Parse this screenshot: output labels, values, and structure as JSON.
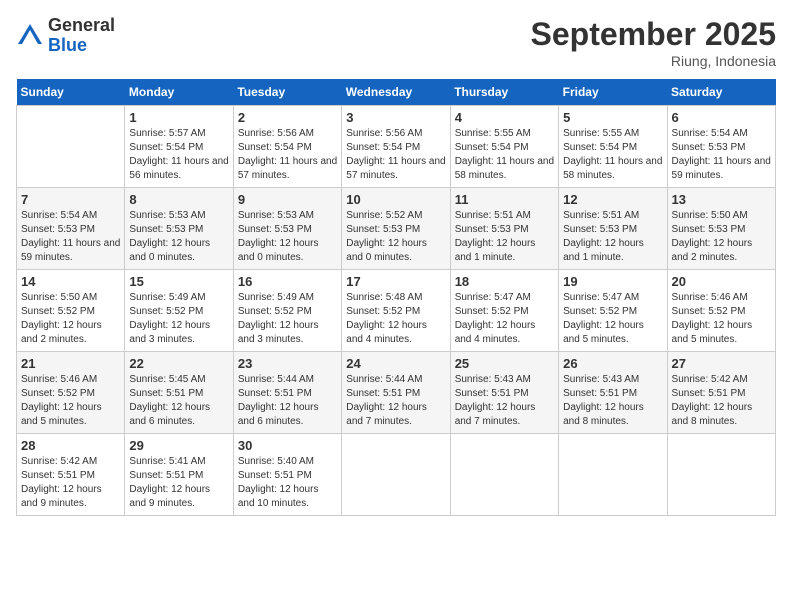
{
  "header": {
    "logo_general": "General",
    "logo_blue": "Blue",
    "month_title": "September 2025",
    "location": "Riung, Indonesia"
  },
  "weekdays": [
    "Sunday",
    "Monday",
    "Tuesday",
    "Wednesday",
    "Thursday",
    "Friday",
    "Saturday"
  ],
  "weeks": [
    [
      {
        "day": "",
        "sunrise": "",
        "sunset": "",
        "daylight": ""
      },
      {
        "day": "1",
        "sunrise": "Sunrise: 5:57 AM",
        "sunset": "Sunset: 5:54 PM",
        "daylight": "Daylight: 11 hours and 56 minutes."
      },
      {
        "day": "2",
        "sunrise": "Sunrise: 5:56 AM",
        "sunset": "Sunset: 5:54 PM",
        "daylight": "Daylight: 11 hours and 57 minutes."
      },
      {
        "day": "3",
        "sunrise": "Sunrise: 5:56 AM",
        "sunset": "Sunset: 5:54 PM",
        "daylight": "Daylight: 11 hours and 57 minutes."
      },
      {
        "day": "4",
        "sunrise": "Sunrise: 5:55 AM",
        "sunset": "Sunset: 5:54 PM",
        "daylight": "Daylight: 11 hours and 58 minutes."
      },
      {
        "day": "5",
        "sunrise": "Sunrise: 5:55 AM",
        "sunset": "Sunset: 5:54 PM",
        "daylight": "Daylight: 11 hours and 58 minutes."
      },
      {
        "day": "6",
        "sunrise": "Sunrise: 5:54 AM",
        "sunset": "Sunset: 5:53 PM",
        "daylight": "Daylight: 11 hours and 59 minutes."
      }
    ],
    [
      {
        "day": "7",
        "sunrise": "Sunrise: 5:54 AM",
        "sunset": "Sunset: 5:53 PM",
        "daylight": "Daylight: 11 hours and 59 minutes."
      },
      {
        "day": "8",
        "sunrise": "Sunrise: 5:53 AM",
        "sunset": "Sunset: 5:53 PM",
        "daylight": "Daylight: 12 hours and 0 minutes."
      },
      {
        "day": "9",
        "sunrise": "Sunrise: 5:53 AM",
        "sunset": "Sunset: 5:53 PM",
        "daylight": "Daylight: 12 hours and 0 minutes."
      },
      {
        "day": "10",
        "sunrise": "Sunrise: 5:52 AM",
        "sunset": "Sunset: 5:53 PM",
        "daylight": "Daylight: 12 hours and 0 minutes."
      },
      {
        "day": "11",
        "sunrise": "Sunrise: 5:51 AM",
        "sunset": "Sunset: 5:53 PM",
        "daylight": "Daylight: 12 hours and 1 minute."
      },
      {
        "day": "12",
        "sunrise": "Sunrise: 5:51 AM",
        "sunset": "Sunset: 5:53 PM",
        "daylight": "Daylight: 12 hours and 1 minute."
      },
      {
        "day": "13",
        "sunrise": "Sunrise: 5:50 AM",
        "sunset": "Sunset: 5:53 PM",
        "daylight": "Daylight: 12 hours and 2 minutes."
      }
    ],
    [
      {
        "day": "14",
        "sunrise": "Sunrise: 5:50 AM",
        "sunset": "Sunset: 5:52 PM",
        "daylight": "Daylight: 12 hours and 2 minutes."
      },
      {
        "day": "15",
        "sunrise": "Sunrise: 5:49 AM",
        "sunset": "Sunset: 5:52 PM",
        "daylight": "Daylight: 12 hours and 3 minutes."
      },
      {
        "day": "16",
        "sunrise": "Sunrise: 5:49 AM",
        "sunset": "Sunset: 5:52 PM",
        "daylight": "Daylight: 12 hours and 3 minutes."
      },
      {
        "day": "17",
        "sunrise": "Sunrise: 5:48 AM",
        "sunset": "Sunset: 5:52 PM",
        "daylight": "Daylight: 12 hours and 4 minutes."
      },
      {
        "day": "18",
        "sunrise": "Sunrise: 5:47 AM",
        "sunset": "Sunset: 5:52 PM",
        "daylight": "Daylight: 12 hours and 4 minutes."
      },
      {
        "day": "19",
        "sunrise": "Sunrise: 5:47 AM",
        "sunset": "Sunset: 5:52 PM",
        "daylight": "Daylight: 12 hours and 5 minutes."
      },
      {
        "day": "20",
        "sunrise": "Sunrise: 5:46 AM",
        "sunset": "Sunset: 5:52 PM",
        "daylight": "Daylight: 12 hours and 5 minutes."
      }
    ],
    [
      {
        "day": "21",
        "sunrise": "Sunrise: 5:46 AM",
        "sunset": "Sunset: 5:52 PM",
        "daylight": "Daylight: 12 hours and 5 minutes."
      },
      {
        "day": "22",
        "sunrise": "Sunrise: 5:45 AM",
        "sunset": "Sunset: 5:51 PM",
        "daylight": "Daylight: 12 hours and 6 minutes."
      },
      {
        "day": "23",
        "sunrise": "Sunrise: 5:44 AM",
        "sunset": "Sunset: 5:51 PM",
        "daylight": "Daylight: 12 hours and 6 minutes."
      },
      {
        "day": "24",
        "sunrise": "Sunrise: 5:44 AM",
        "sunset": "Sunset: 5:51 PM",
        "daylight": "Daylight: 12 hours and 7 minutes."
      },
      {
        "day": "25",
        "sunrise": "Sunrise: 5:43 AM",
        "sunset": "Sunset: 5:51 PM",
        "daylight": "Daylight: 12 hours and 7 minutes."
      },
      {
        "day": "26",
        "sunrise": "Sunrise: 5:43 AM",
        "sunset": "Sunset: 5:51 PM",
        "daylight": "Daylight: 12 hours and 8 minutes."
      },
      {
        "day": "27",
        "sunrise": "Sunrise: 5:42 AM",
        "sunset": "Sunset: 5:51 PM",
        "daylight": "Daylight: 12 hours and 8 minutes."
      }
    ],
    [
      {
        "day": "28",
        "sunrise": "Sunrise: 5:42 AM",
        "sunset": "Sunset: 5:51 PM",
        "daylight": "Daylight: 12 hours and 9 minutes."
      },
      {
        "day": "29",
        "sunrise": "Sunrise: 5:41 AM",
        "sunset": "Sunset: 5:51 PM",
        "daylight": "Daylight: 12 hours and 9 minutes."
      },
      {
        "day": "30",
        "sunrise": "Sunrise: 5:40 AM",
        "sunset": "Sunset: 5:51 PM",
        "daylight": "Daylight: 12 hours and 10 minutes."
      },
      {
        "day": "",
        "sunrise": "",
        "sunset": "",
        "daylight": ""
      },
      {
        "day": "",
        "sunrise": "",
        "sunset": "",
        "daylight": ""
      },
      {
        "day": "",
        "sunrise": "",
        "sunset": "",
        "daylight": ""
      },
      {
        "day": "",
        "sunrise": "",
        "sunset": "",
        "daylight": ""
      }
    ]
  ]
}
